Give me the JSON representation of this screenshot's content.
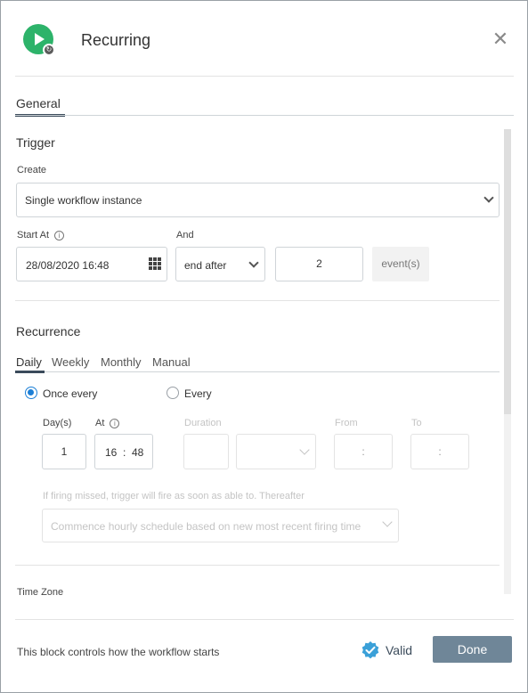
{
  "header": {
    "title": "Recurring"
  },
  "tabs": {
    "general": "General"
  },
  "trigger": {
    "heading": "Trigger",
    "create_label": "Create",
    "create_value": "Single workflow instance",
    "start_at_label": "Start At",
    "start_at_value": "28/08/2020 16:48",
    "and_label": "And",
    "and_value": "end after",
    "count_value": "2",
    "unit_label": "event(s)"
  },
  "recurrence": {
    "heading": "Recurrence",
    "tabs": [
      "Daily",
      "Weekly",
      "Monthly",
      "Manual"
    ],
    "once_every_label": "Once every",
    "every_label": "Every",
    "days_label": "Day(s)",
    "days_value": "1",
    "at_label": "At",
    "at_hour": "16",
    "at_sep": ":",
    "at_minute": "48",
    "duration_label": "Duration",
    "from_label": "From",
    "from_value": ":",
    "to_label": "To",
    "to_value": ":",
    "missed_label": "If firing missed, trigger will fire as soon as able to. Thereafter",
    "missed_value": "Commence hourly schedule based on new most recent firing time"
  },
  "timezone": {
    "label": "Time Zone"
  },
  "footer": {
    "description": "This block controls how the workflow starts",
    "valid_label": "Valid",
    "done_label": "Done"
  },
  "colors": {
    "accent": "#1c7fd6",
    "done_button": "#6f8698",
    "logo": "#2db36a"
  },
  "icons": [
    "play-icon",
    "recurring-icon",
    "close-icon",
    "chevron-down-icon",
    "info-icon",
    "calendar-icon",
    "valid-badge-icon"
  ]
}
